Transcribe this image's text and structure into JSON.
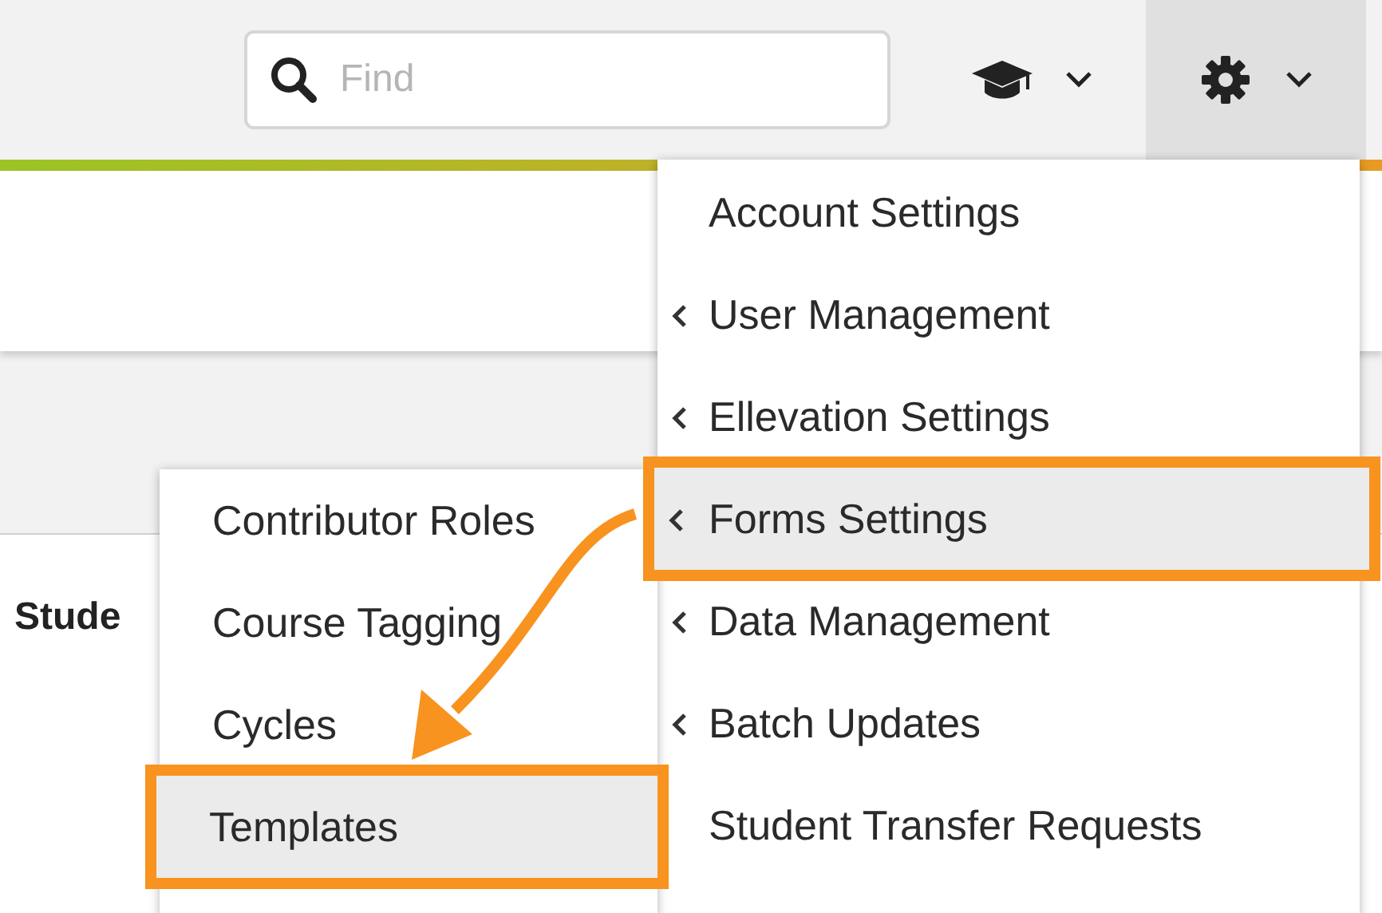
{
  "search": {
    "placeholder": "Find"
  },
  "page": {
    "section_label": "Stude"
  },
  "settings_menu": [
    {
      "label": "Account Settings",
      "expandable": false,
      "selected": false,
      "annotated": false
    },
    {
      "label": "User Management",
      "expandable": true,
      "selected": false,
      "annotated": false
    },
    {
      "label": "Ellevation Settings",
      "expandable": true,
      "selected": false,
      "annotated": false
    },
    {
      "label": "Forms Settings",
      "expandable": true,
      "selected": true,
      "annotated": true
    },
    {
      "label": "Data Management",
      "expandable": true,
      "selected": false,
      "annotated": false
    },
    {
      "label": "Batch Updates",
      "expandable": true,
      "selected": false,
      "annotated": false
    },
    {
      "label": "Student Transfer Requests",
      "expandable": false,
      "selected": false,
      "annotated": false
    }
  ],
  "forms_submenu": [
    {
      "label": "Contributor Roles",
      "selected": false,
      "annotated": false
    },
    {
      "label": "Course Tagging",
      "selected": false,
      "annotated": false
    },
    {
      "label": "Cycles",
      "selected": false,
      "annotated": false
    },
    {
      "label": "Templates",
      "selected": true,
      "annotated": true
    }
  ]
}
